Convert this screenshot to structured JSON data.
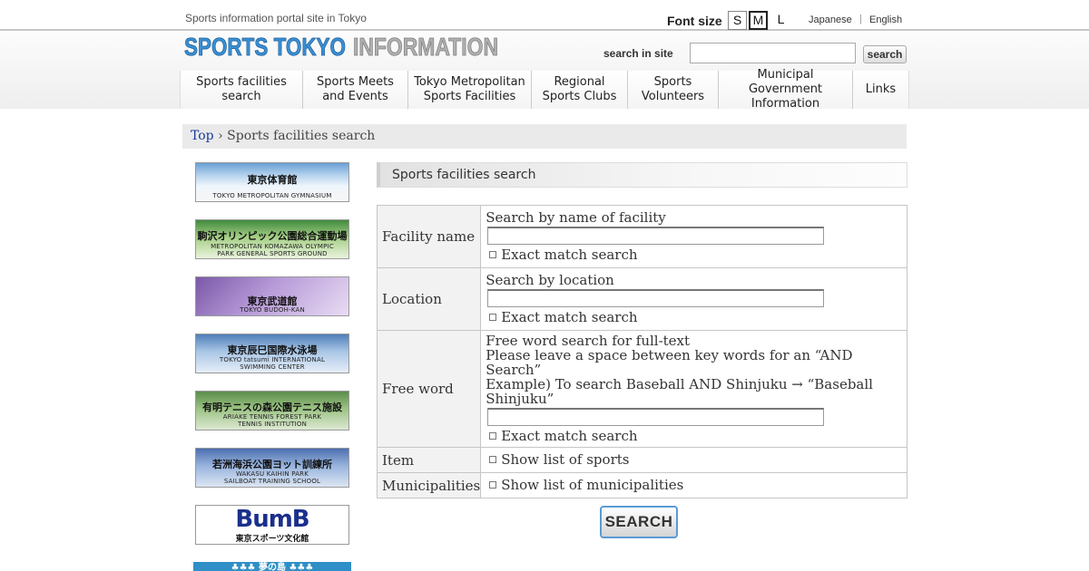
{
  "header": {
    "tagline": "Sports information portal site in Tokyo",
    "logo_text_blue": "SPORTS TOKYO",
    "logo_text_gray": "INFORMATION",
    "font_size_label": "Font size",
    "font_sizes": [
      "S",
      "M",
      "L"
    ],
    "font_size_selected": "M",
    "languages": [
      "Japanese",
      "English"
    ],
    "search_label": "search in site",
    "search_value": "",
    "search_button": "search"
  },
  "nav": {
    "items": [
      [
        "Sports facilities",
        "search"
      ],
      [
        "Sports Meets",
        "and Events"
      ],
      [
        "Tokyo Metropolitan",
        "Sports Facilities"
      ],
      [
        "Regional",
        "Sports Clubs"
      ],
      [
        "Sports",
        "Volunteers"
      ],
      [
        "Municipal Government",
        "Information"
      ],
      [
        "Links"
      ]
    ]
  },
  "breadcrumb": {
    "home": "Top",
    "separator": "›",
    "current": "Sports facilities search"
  },
  "sidebar": {
    "banners": [
      {
        "jp": "東京体育館",
        "en": [
          "TOKYO METROPOLITAN GYMNASIUM"
        ]
      },
      {
        "jp": "駒沢オリンピック公園総合運動場",
        "en": [
          "METROPOLITAN KOMAZAWA OLYMPIC",
          "PARK GENERAL SPORTS GROUND"
        ]
      },
      {
        "jp": "東京武道館",
        "en": [
          "TOKYO BUDOH-KAN"
        ]
      },
      {
        "jp": "東京辰巳国際水泳場",
        "en": [
          "TOKYO tatsumi INTERNATIONAL",
          "SWIMMING CENTER"
        ]
      },
      {
        "jp": "有明テニスの森公園テニス施設",
        "en": [
          "ARIAKE TENNIS FOREST PARK",
          "TENNIS INSTITUTION"
        ]
      },
      {
        "jp": "若洲海浜公園ヨット訓練所",
        "en": [
          "WAKASU KAIHIN PARK",
          "SAILBOAT TRAINING SCHOOL"
        ]
      },
      {
        "logo": "BumB",
        "jp": "東京スポーツ文化館"
      },
      {
        "jp": "♣♣♣ 夢の島 ♣♣♣"
      }
    ]
  },
  "main": {
    "section_title": "Sports facilities search",
    "form": {
      "facility_name": {
        "label": "Facility name",
        "hint": "Search by name of facility",
        "value": "",
        "exact_label": "Exact match search"
      },
      "location": {
        "label": "Location",
        "hint": "Search by location",
        "value": "",
        "exact_label": "Exact match search"
      },
      "free_word": {
        "label": "Free word",
        "hint_lines": [
          "Free word search for full-text",
          "Please leave a space between key words for an “AND Search”",
          "Example) To search Baseball AND Shinjuku → “Baseball",
          "Shinjuku”"
        ],
        "value": "",
        "exact_label": "Exact match search"
      },
      "item": {
        "label": "Item",
        "option_label": "Show list of sports"
      },
      "municipalities": {
        "label": "Municipalities",
        "option_label": "Show list of municipalities"
      }
    },
    "submit_label": "SEARCH"
  },
  "colors": {
    "logo_blue": "#3a8fd3",
    "logo_gray": "#a9a9a9",
    "link_blue": "#1a3b9c",
    "breadcrumb_bg": "#eaeaea",
    "table_label_bg": "#f2f2f2"
  }
}
